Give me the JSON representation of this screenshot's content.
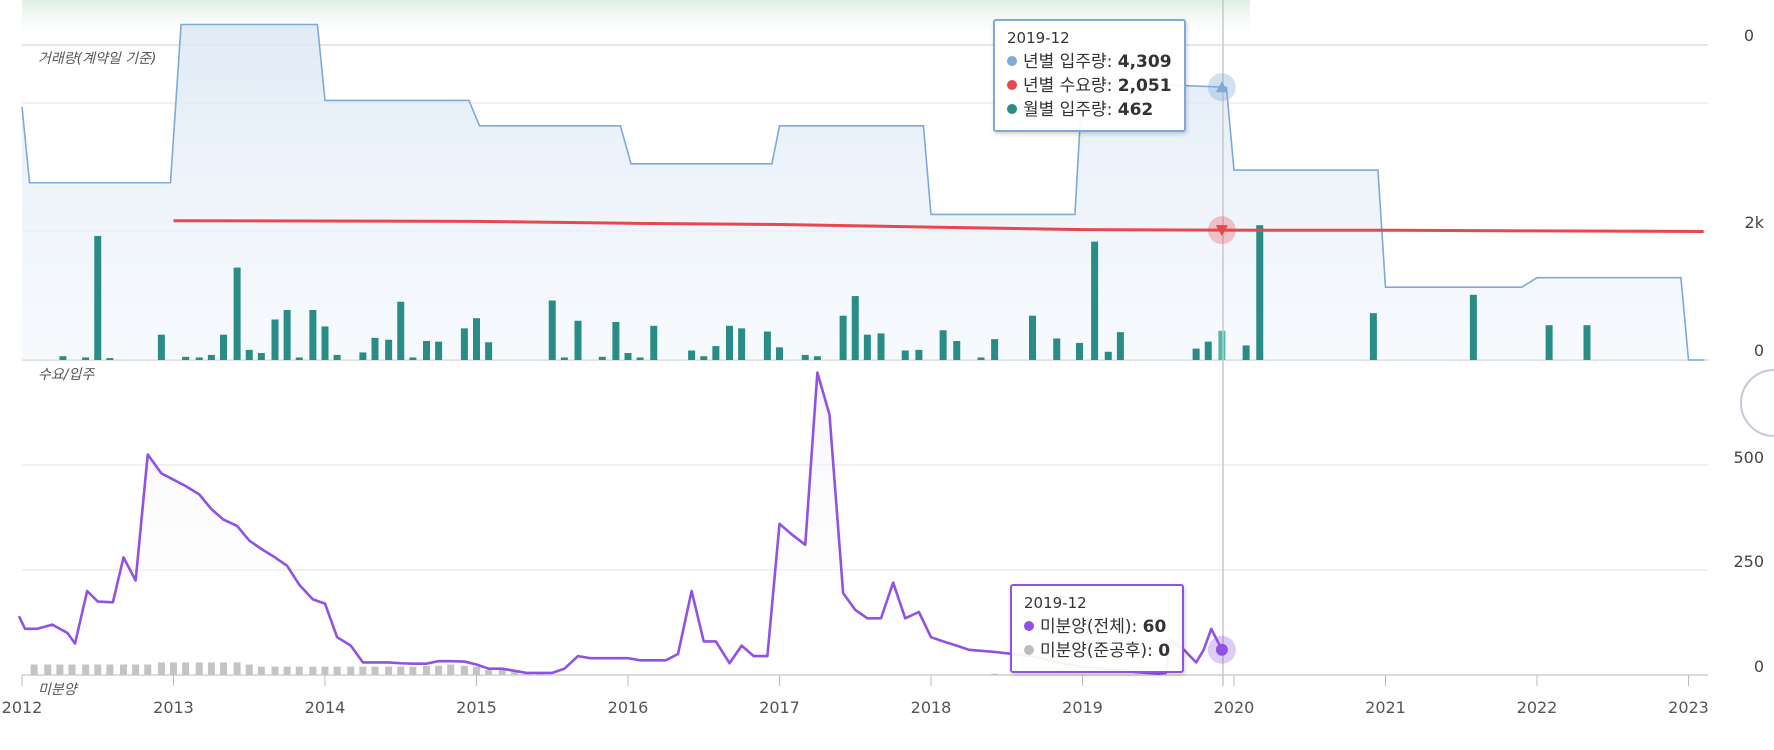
{
  "colors": {
    "annual_supply": "#7ea9d8",
    "annual_demand": "#e8474d",
    "monthly_supply": "#2a8c86",
    "unsold_total": "#9152e3",
    "unsold_completed": "#bdbdbd"
  },
  "panels": {
    "top_label": "거래량(계약일 기준)",
    "middle_label": "수요/입주",
    "bottom_label": "미분양"
  },
  "tooltip_supply": {
    "date": "2019-12",
    "rows": [
      {
        "label": "년별 입주량",
        "value": "4,309",
        "color": "#7ea9d8"
      },
      {
        "label": "년별 수요량",
        "value": "2,051",
        "color": "#e8474d"
      },
      {
        "label": "월별 입주량",
        "value": "462",
        "color": "#2a8c86"
      }
    ]
  },
  "tooltip_unsold": {
    "date": "2019-12",
    "rows": [
      {
        "label": "미분양(전체)",
        "value": "60",
        "color": "#9152e3"
      },
      {
        "label": "미분양(준공후)",
        "value": "0",
        "color": "#bdbdbd"
      }
    ]
  },
  "chart_data": [
    {
      "type": "bar",
      "title": "거래량(계약일 기준)",
      "y_ticks": [
        "0"
      ]
    },
    {
      "type": "line",
      "title": "수요/입주",
      "x_ticks": [
        "2012",
        "2013",
        "2014",
        "2015",
        "2016",
        "2017",
        "2018",
        "2019",
        "2020",
        "2021",
        "2022",
        "2023"
      ],
      "y_ticks": [
        "2k",
        "0"
      ],
      "ylim": [
        0,
        5600
      ],
      "series": [
        {
          "name": "년별 입주량",
          "kind": "area-step",
          "points": [
            [
              2012.0,
              4000
            ],
            [
              2012.05,
              2800
            ],
            [
              2012.98,
              2800
            ],
            [
              2013.05,
              5300
            ],
            [
              2013.95,
              5300
            ],
            [
              2014.0,
              4100
            ],
            [
              2014.95,
              4100
            ],
            [
              2015.02,
              3700
            ],
            [
              2015.95,
              3700
            ],
            [
              2016.02,
              3100
            ],
            [
              2016.95,
              3100
            ],
            [
              2017.0,
              3700
            ],
            [
              2017.95,
              3700
            ],
            [
              2018.0,
              2300
            ],
            [
              2018.95,
              2300
            ],
            [
              2019.0,
              4400
            ],
            [
              2019.95,
              4309
            ],
            [
              2020.0,
              3000
            ],
            [
              2020.95,
              3000
            ],
            [
              2021.0,
              1150
            ],
            [
              2021.9,
              1150
            ],
            [
              2022.0,
              1300
            ],
            [
              2022.95,
              1300
            ],
            [
              2023.0,
              0
            ],
            [
              2023.1,
              0
            ]
          ]
        },
        {
          "name": "년별 수요량",
          "kind": "line",
          "points": [
            [
              2013.0,
              2200
            ],
            [
              2015.0,
              2190
            ],
            [
              2016.0,
              2160
            ],
            [
              2017.0,
              2140
            ],
            [
              2018.0,
              2100
            ],
            [
              2019.0,
              2060
            ],
            [
              2019.92,
              2051
            ],
            [
              2021.0,
              2050
            ],
            [
              2022.0,
              2040
            ],
            [
              2023.1,
              2030
            ]
          ]
        },
        {
          "name": "월별 입주량",
          "kind": "bar",
          "points": [
            [
              2012.27,
              60
            ],
            [
              2012.42,
              40
            ],
            [
              2012.5,
              1960
            ],
            [
              2012.58,
              30
            ],
            [
              2012.92,
              400
            ],
            [
              2013.08,
              50
            ],
            [
              2013.17,
              40
            ],
            [
              2013.25,
              80
            ],
            [
              2013.33,
              400
            ],
            [
              2013.42,
              1460
            ],
            [
              2013.5,
              160
            ],
            [
              2013.58,
              110
            ],
            [
              2013.67,
              640
            ],
            [
              2013.75,
              790
            ],
            [
              2013.83,
              40
            ],
            [
              2013.92,
              790
            ],
            [
              2014.0,
              530
            ],
            [
              2014.08,
              80
            ],
            [
              2014.25,
              120
            ],
            [
              2014.33,
              350
            ],
            [
              2014.42,
              320
            ],
            [
              2014.5,
              920
            ],
            [
              2014.58,
              40
            ],
            [
              2014.67,
              300
            ],
            [
              2014.75,
              290
            ],
            [
              2014.92,
              500
            ],
            [
              2015.0,
              660
            ],
            [
              2015.08,
              280
            ],
            [
              2015.5,
              940
            ],
            [
              2015.58,
              40
            ],
            [
              2015.67,
              620
            ],
            [
              2015.83,
              50
            ],
            [
              2015.92,
              600
            ],
            [
              2016.0,
              110
            ],
            [
              2016.08,
              40
            ],
            [
              2016.17,
              540
            ],
            [
              2016.42,
              150
            ],
            [
              2016.5,
              60
            ],
            [
              2016.58,
              220
            ],
            [
              2016.67,
              540
            ],
            [
              2016.75,
              500
            ],
            [
              2016.92,
              450
            ],
            [
              2017.0,
              200
            ],
            [
              2017.17,
              80
            ],
            [
              2017.25,
              60
            ],
            [
              2017.42,
              700
            ],
            [
              2017.5,
              1010
            ],
            [
              2017.58,
              400
            ],
            [
              2017.67,
              420
            ],
            [
              2017.83,
              150
            ],
            [
              2017.92,
              160
            ],
            [
              2018.08,
              470
            ],
            [
              2018.17,
              300
            ],
            [
              2018.33,
              40
            ],
            [
              2018.42,
              330
            ],
            [
              2018.67,
              700
            ],
            [
              2018.83,
              340
            ],
            [
              2018.98,
              270
            ],
            [
              2019.08,
              1870
            ],
            [
              2019.17,
              130
            ],
            [
              2019.25,
              440
            ],
            [
              2019.75,
              180
            ],
            [
              2019.83,
              290
            ],
            [
              2019.92,
              462
            ],
            [
              2020.08,
              230
            ],
            [
              2020.17,
              2130
            ],
            [
              2020.92,
              740
            ],
            [
              2021.58,
              1030
            ],
            [
              2022.08,
              550
            ],
            [
              2022.33,
              550
            ]
          ]
        }
      ]
    },
    {
      "type": "line",
      "title": "미분양",
      "x_ticks": [
        "2012",
        "2013",
        "2014",
        "2015",
        "2016",
        "2017",
        "2018",
        "2019",
        "2020",
        "2021",
        "2022",
        "2023"
      ],
      "y_ticks": [
        "500",
        "250",
        "0"
      ],
      "ylim": [
        0,
        750
      ],
      "series": [
        {
          "name": "미분양(전체)",
          "points": [
            [
              2011.98,
              140
            ],
            [
              2012.02,
              110
            ],
            [
              2012.1,
              110
            ],
            [
              2012.2,
              120
            ],
            [
              2012.3,
              100
            ],
            [
              2012.35,
              75
            ],
            [
              2012.43,
              200
            ],
            [
              2012.5,
              175
            ],
            [
              2012.6,
              173
            ],
            [
              2012.67,
              280
            ],
            [
              2012.75,
              225
            ],
            [
              2012.83,
              525
            ],
            [
              2012.92,
              480
            ],
            [
              2013.0,
              465
            ],
            [
              2013.08,
              450
            ],
            [
              2013.17,
              430
            ],
            [
              2013.25,
              395
            ],
            [
              2013.33,
              370
            ],
            [
              2013.42,
              355
            ],
            [
              2013.5,
              320
            ],
            [
              2013.58,
              300
            ],
            [
              2013.67,
              280
            ],
            [
              2013.75,
              260
            ],
            [
              2013.83,
              215
            ],
            [
              2013.92,
              180
            ],
            [
              2014.0,
              170
            ],
            [
              2014.08,
              90
            ],
            [
              2014.17,
              70
            ],
            [
              2014.25,
              30
            ],
            [
              2014.33,
              30
            ],
            [
              2014.42,
              30
            ],
            [
              2014.5,
              28
            ],
            [
              2014.58,
              27
            ],
            [
              2014.67,
              27
            ],
            [
              2014.75,
              33
            ],
            [
              2014.83,
              33
            ],
            [
              2014.92,
              32
            ],
            [
              2015.0,
              25
            ],
            [
              2015.08,
              15
            ],
            [
              2015.17,
              15
            ],
            [
              2015.25,
              10
            ],
            [
              2015.33,
              5
            ],
            [
              2015.42,
              5
            ],
            [
              2015.5,
              5
            ],
            [
              2015.58,
              15
            ],
            [
              2015.67,
              45
            ],
            [
              2015.75,
              40
            ],
            [
              2015.83,
              40
            ],
            [
              2015.92,
              40
            ],
            [
              2016.0,
              40
            ],
            [
              2016.08,
              35
            ],
            [
              2016.17,
              35
            ],
            [
              2016.25,
              35
            ],
            [
              2016.33,
              50
            ],
            [
              2016.42,
              200
            ],
            [
              2016.5,
              80
            ],
            [
              2016.58,
              80
            ],
            [
              2016.67,
              28
            ],
            [
              2016.75,
              70
            ],
            [
              2016.83,
              45
            ],
            [
              2016.92,
              45
            ],
            [
              2017.0,
              360
            ],
            [
              2017.08,
              335
            ],
            [
              2017.17,
              310
            ],
            [
              2017.25,
              720
            ],
            [
              2017.33,
              620
            ],
            [
              2017.42,
              195
            ],
            [
              2017.5,
              155
            ],
            [
              2017.58,
              135
            ],
            [
              2017.67,
              135
            ],
            [
              2017.75,
              220
            ],
            [
              2017.83,
              135
            ],
            [
              2017.92,
              150
            ],
            [
              2018.0,
              90
            ],
            [
              2018.08,
              80
            ],
            [
              2018.17,
              70
            ],
            [
              2018.25,
              60
            ],
            [
              2018.42,
              55
            ],
            [
              2018.67,
              45
            ],
            [
              2018.83,
              30
            ],
            [
              2019.0,
              20
            ],
            [
              2019.25,
              10
            ],
            [
              2019.5,
              3
            ],
            [
              2019.55,
              5
            ],
            [
              2019.58,
              85
            ],
            [
              2019.67,
              60
            ],
            [
              2019.75,
              30
            ],
            [
              2019.8,
              60
            ],
            [
              2019.85,
              110
            ],
            [
              2019.92,
              60
            ]
          ]
        },
        {
          "name": "미분양(준공후)",
          "kind": "bar",
          "points": [
            [
              2012.08,
              25
            ],
            [
              2012.17,
              25
            ],
            [
              2012.25,
              25
            ],
            [
              2012.33,
              25
            ],
            [
              2012.42,
              25
            ],
            [
              2012.5,
              25
            ],
            [
              2012.58,
              25
            ],
            [
              2012.67,
              25
            ],
            [
              2012.75,
              25
            ],
            [
              2012.83,
              25
            ],
            [
              2012.92,
              30
            ],
            [
              2013.0,
              30
            ],
            [
              2013.08,
              30
            ],
            [
              2013.17,
              30
            ],
            [
              2013.25,
              30
            ],
            [
              2013.33,
              30
            ],
            [
              2013.42,
              30
            ],
            [
              2013.5,
              25
            ],
            [
              2013.58,
              20
            ],
            [
              2013.67,
              20
            ],
            [
              2013.75,
              20
            ],
            [
              2013.83,
              20
            ],
            [
              2013.92,
              20
            ],
            [
              2014.0,
              20
            ],
            [
              2014.08,
              20
            ],
            [
              2014.17,
              20
            ],
            [
              2014.25,
              20
            ],
            [
              2014.33,
              20
            ],
            [
              2014.42,
              20
            ],
            [
              2014.5,
              20
            ],
            [
              2014.58,
              20
            ],
            [
              2014.67,
              22
            ],
            [
              2014.75,
              22
            ],
            [
              2014.83,
              25
            ],
            [
              2014.92,
              22
            ],
            [
              2015.0,
              20
            ],
            [
              2015.08,
              12
            ],
            [
              2015.17,
              12
            ],
            [
              2015.25,
              8
            ],
            [
              2015.33,
              5
            ],
            [
              2015.42,
              3
            ],
            [
              2018.42,
              3
            ],
            [
              2019.92,
              0
            ]
          ]
        }
      ]
    }
  ]
}
